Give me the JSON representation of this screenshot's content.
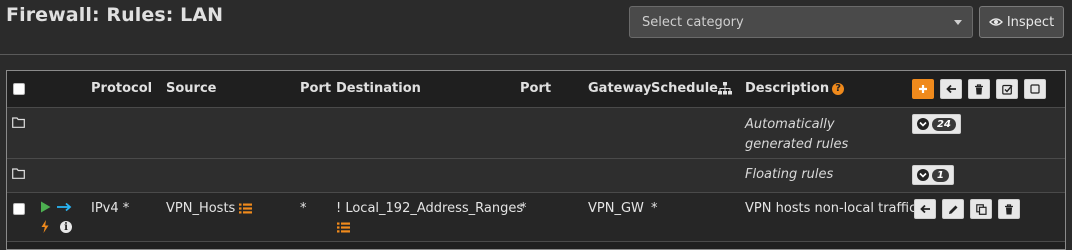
{
  "page": {
    "title": "Firewall: Rules: LAN"
  },
  "category": {
    "placeholder": "Select category"
  },
  "inspect": {
    "label": "Inspect"
  },
  "table": {
    "headers": {
      "protocol": "Protocol",
      "source": "Source",
      "source_port": "Port",
      "destination": "Destination",
      "destination_port": "Port",
      "gateway": "Gateway",
      "schedule": "Schedule",
      "description": "Description"
    },
    "auto_row": {
      "label": "Automatically generated rules",
      "count": "24"
    },
    "floating_row": {
      "label": "Floating rules",
      "count": "1"
    },
    "rule": {
      "protocol": "IPv4 *",
      "source": "VPN_Hosts",
      "source_port": "*",
      "destination": "! Local_192_Address_Ranges",
      "destination_port": "*",
      "gateway": "VPN_GW",
      "schedule": "*",
      "description": "VPN hosts non-local traffic"
    }
  },
  "colors": {
    "accent": "#f08a1c",
    "pass_arrow": "#4caf50",
    "direction_arrow": "#29b6f6"
  },
  "icons": {
    "header_actions": [
      "plus-icon",
      "arrow-left-icon",
      "trash-icon",
      "check-square-icon",
      "square-icon"
    ],
    "rule_actions": [
      "arrow-left-icon",
      "pencil-icon",
      "copy-icon",
      "trash-icon"
    ]
  }
}
